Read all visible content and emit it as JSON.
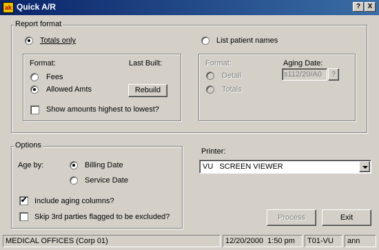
{
  "window": {
    "title": "Quick A/R",
    "app_icon": "ak",
    "help_label": "?",
    "close_label": "X"
  },
  "report_format": {
    "legend": "Report format",
    "totals_only": {
      "label": "Totals only",
      "selected": true
    },
    "list_patient_names": {
      "label": "List patient names",
      "selected": false
    },
    "left_panel": {
      "format_label": "Format:",
      "last_built_label": "Last Built:",
      "fees": {
        "label": "Fees",
        "selected": false
      },
      "allowed_amts": {
        "label": "Allowed Amts",
        "selected": true
      },
      "rebuild_label": "Rebuild",
      "show_highest": {
        "label": "Show amounts highest to lowest?",
        "checked": false
      }
    },
    "right_panel": {
      "format_label": "Format:",
      "aging_date_label": "Aging Date:",
      "aging_date_value": "s112/20/A0",
      "aging_date_button": "?",
      "detail": {
        "label": "Detail",
        "selected": false,
        "disabled": true
      },
      "totals": {
        "label": "Totals",
        "selected": false,
        "disabled": true
      }
    }
  },
  "options": {
    "legend": "Options",
    "age_by_label": "Age by:",
    "billing_date": {
      "label": "Billing Date",
      "selected": true
    },
    "service_date": {
      "label": "Service Date",
      "selected": false
    },
    "include_aging": {
      "label": "Include aging columns?",
      "checked": true
    },
    "skip_3rd": {
      "label": "Skip 3rd parties flagged to be excluded?",
      "checked": false
    }
  },
  "printer": {
    "label": "Printer:",
    "value": "VU   SCREEN VIEWER"
  },
  "buttons": {
    "process": "Process",
    "exit": "Exit"
  },
  "status_bar": {
    "office": "MEDICAL OFFICES (Corp 01)",
    "datetime": "12/20/2000  1:50 pm",
    "terminal": "T01-VU",
    "user": "ann"
  }
}
